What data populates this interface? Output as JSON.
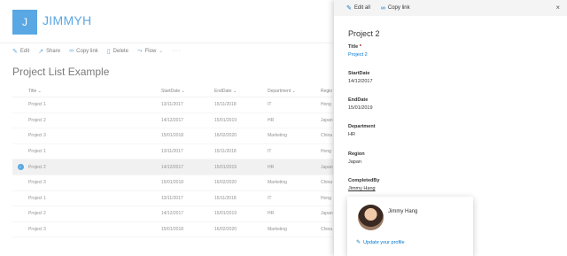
{
  "site": {
    "logo_letter": "J",
    "title": "JIMMYH"
  },
  "commandbar": {
    "edit": "Edit",
    "share": "Share",
    "copy_link": "Copy link",
    "delete": "Delete",
    "flow": "Flow",
    "more": "···"
  },
  "list": {
    "title": "Project List Example",
    "columns": [
      "Title",
      "StartDate",
      "EndDate",
      "Department",
      "Regio"
    ],
    "rows": [
      {
        "title": "Project 1",
        "start": "13/11/2017",
        "end": "15/11/2018",
        "dept": "IT",
        "region": "Hong"
      },
      {
        "title": "Project 2",
        "start": "14/12/2017",
        "end": "15/01/2019",
        "dept": "HR",
        "region": "Japan"
      },
      {
        "title": "Project 3",
        "start": "15/01/2018",
        "end": "16/02/2020",
        "dept": "Marketing",
        "region": "China"
      },
      {
        "title": "Project 1",
        "start": "13/11/2017",
        "end": "15/11/2018",
        "dept": "IT",
        "region": "Hong"
      },
      {
        "title": "Project 2",
        "start": "14/12/2017",
        "end": "15/01/2019",
        "dept": "HR",
        "region": "Japan",
        "selected": true
      },
      {
        "title": "Project 3",
        "start": "15/01/2018",
        "end": "16/02/2020",
        "dept": "Marketing",
        "region": "China"
      },
      {
        "title": "Project 1",
        "start": "13/11/2017",
        "end": "15/11/2018",
        "dept": "IT",
        "region": "Hong"
      },
      {
        "title": "Project 2",
        "start": "14/12/2017",
        "end": "15/01/2019",
        "dept": "HR",
        "region": "Japan"
      },
      {
        "title": "Project 3",
        "start": "15/01/2018",
        "end": "16/02/2020",
        "dept": "Marketing",
        "region": "China"
      }
    ]
  },
  "panel": {
    "edit_all": "Edit all",
    "copy_link": "Copy link",
    "close": "×",
    "heading": "Project 2",
    "fields": {
      "title_label": "Title",
      "title_required": "*",
      "title_value": "Project 2",
      "start_label": "StartDate",
      "start_value": "14/12/2017",
      "end_label": "EndDate",
      "end_value": "15/01/2019",
      "dept_label": "Department",
      "dept_value": "HR",
      "region_label": "Region",
      "region_value": "Japan",
      "completed_label": "CompletedBy",
      "completed_value": "Jimmy Hang"
    }
  },
  "profile_card": {
    "name": "Jimmy Hang",
    "update_link": "Update your profile"
  },
  "colors": {
    "accent": "#0078d4"
  }
}
